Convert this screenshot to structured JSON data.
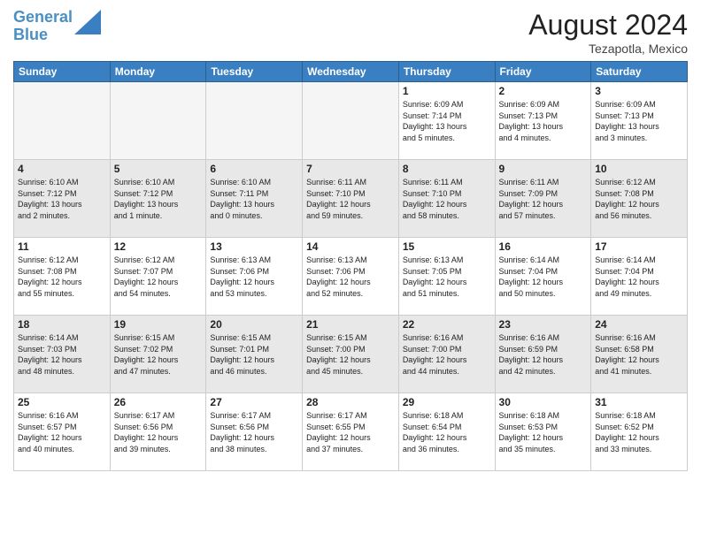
{
  "header": {
    "logo_line1": "General",
    "logo_line2": "Blue",
    "month_year": "August 2024",
    "location": "Tezapotla, Mexico"
  },
  "weekdays": [
    "Sunday",
    "Monday",
    "Tuesday",
    "Wednesday",
    "Thursday",
    "Friday",
    "Saturday"
  ],
  "weeks": [
    [
      {
        "day": "",
        "info": ""
      },
      {
        "day": "",
        "info": ""
      },
      {
        "day": "",
        "info": ""
      },
      {
        "day": "",
        "info": ""
      },
      {
        "day": "1",
        "info": "Sunrise: 6:09 AM\nSunset: 7:14 PM\nDaylight: 13 hours\nand 5 minutes."
      },
      {
        "day": "2",
        "info": "Sunrise: 6:09 AM\nSunset: 7:13 PM\nDaylight: 13 hours\nand 4 minutes."
      },
      {
        "day": "3",
        "info": "Sunrise: 6:09 AM\nSunset: 7:13 PM\nDaylight: 13 hours\nand 3 minutes."
      }
    ],
    [
      {
        "day": "4",
        "info": "Sunrise: 6:10 AM\nSunset: 7:12 PM\nDaylight: 13 hours\nand 2 minutes."
      },
      {
        "day": "5",
        "info": "Sunrise: 6:10 AM\nSunset: 7:12 PM\nDaylight: 13 hours\nand 1 minute."
      },
      {
        "day": "6",
        "info": "Sunrise: 6:10 AM\nSunset: 7:11 PM\nDaylight: 13 hours\nand 0 minutes."
      },
      {
        "day": "7",
        "info": "Sunrise: 6:11 AM\nSunset: 7:10 PM\nDaylight: 12 hours\nand 59 minutes."
      },
      {
        "day": "8",
        "info": "Sunrise: 6:11 AM\nSunset: 7:10 PM\nDaylight: 12 hours\nand 58 minutes."
      },
      {
        "day": "9",
        "info": "Sunrise: 6:11 AM\nSunset: 7:09 PM\nDaylight: 12 hours\nand 57 minutes."
      },
      {
        "day": "10",
        "info": "Sunrise: 6:12 AM\nSunset: 7:08 PM\nDaylight: 12 hours\nand 56 minutes."
      }
    ],
    [
      {
        "day": "11",
        "info": "Sunrise: 6:12 AM\nSunset: 7:08 PM\nDaylight: 12 hours\nand 55 minutes."
      },
      {
        "day": "12",
        "info": "Sunrise: 6:12 AM\nSunset: 7:07 PM\nDaylight: 12 hours\nand 54 minutes."
      },
      {
        "day": "13",
        "info": "Sunrise: 6:13 AM\nSunset: 7:06 PM\nDaylight: 12 hours\nand 53 minutes."
      },
      {
        "day": "14",
        "info": "Sunrise: 6:13 AM\nSunset: 7:06 PM\nDaylight: 12 hours\nand 52 minutes."
      },
      {
        "day": "15",
        "info": "Sunrise: 6:13 AM\nSunset: 7:05 PM\nDaylight: 12 hours\nand 51 minutes."
      },
      {
        "day": "16",
        "info": "Sunrise: 6:14 AM\nSunset: 7:04 PM\nDaylight: 12 hours\nand 50 minutes."
      },
      {
        "day": "17",
        "info": "Sunrise: 6:14 AM\nSunset: 7:04 PM\nDaylight: 12 hours\nand 49 minutes."
      }
    ],
    [
      {
        "day": "18",
        "info": "Sunrise: 6:14 AM\nSunset: 7:03 PM\nDaylight: 12 hours\nand 48 minutes."
      },
      {
        "day": "19",
        "info": "Sunrise: 6:15 AM\nSunset: 7:02 PM\nDaylight: 12 hours\nand 47 minutes."
      },
      {
        "day": "20",
        "info": "Sunrise: 6:15 AM\nSunset: 7:01 PM\nDaylight: 12 hours\nand 46 minutes."
      },
      {
        "day": "21",
        "info": "Sunrise: 6:15 AM\nSunset: 7:00 PM\nDaylight: 12 hours\nand 45 minutes."
      },
      {
        "day": "22",
        "info": "Sunrise: 6:16 AM\nSunset: 7:00 PM\nDaylight: 12 hours\nand 44 minutes."
      },
      {
        "day": "23",
        "info": "Sunrise: 6:16 AM\nSunset: 6:59 PM\nDaylight: 12 hours\nand 42 minutes."
      },
      {
        "day": "24",
        "info": "Sunrise: 6:16 AM\nSunset: 6:58 PM\nDaylight: 12 hours\nand 41 minutes."
      }
    ],
    [
      {
        "day": "25",
        "info": "Sunrise: 6:16 AM\nSunset: 6:57 PM\nDaylight: 12 hours\nand 40 minutes."
      },
      {
        "day": "26",
        "info": "Sunrise: 6:17 AM\nSunset: 6:56 PM\nDaylight: 12 hours\nand 39 minutes."
      },
      {
        "day": "27",
        "info": "Sunrise: 6:17 AM\nSunset: 6:56 PM\nDaylight: 12 hours\nand 38 minutes."
      },
      {
        "day": "28",
        "info": "Sunrise: 6:17 AM\nSunset: 6:55 PM\nDaylight: 12 hours\nand 37 minutes."
      },
      {
        "day": "29",
        "info": "Sunrise: 6:18 AM\nSunset: 6:54 PM\nDaylight: 12 hours\nand 36 minutes."
      },
      {
        "day": "30",
        "info": "Sunrise: 6:18 AM\nSunset: 6:53 PM\nDaylight: 12 hours\nand 35 minutes."
      },
      {
        "day": "31",
        "info": "Sunrise: 6:18 AM\nSunset: 6:52 PM\nDaylight: 12 hours\nand 33 minutes."
      }
    ]
  ]
}
